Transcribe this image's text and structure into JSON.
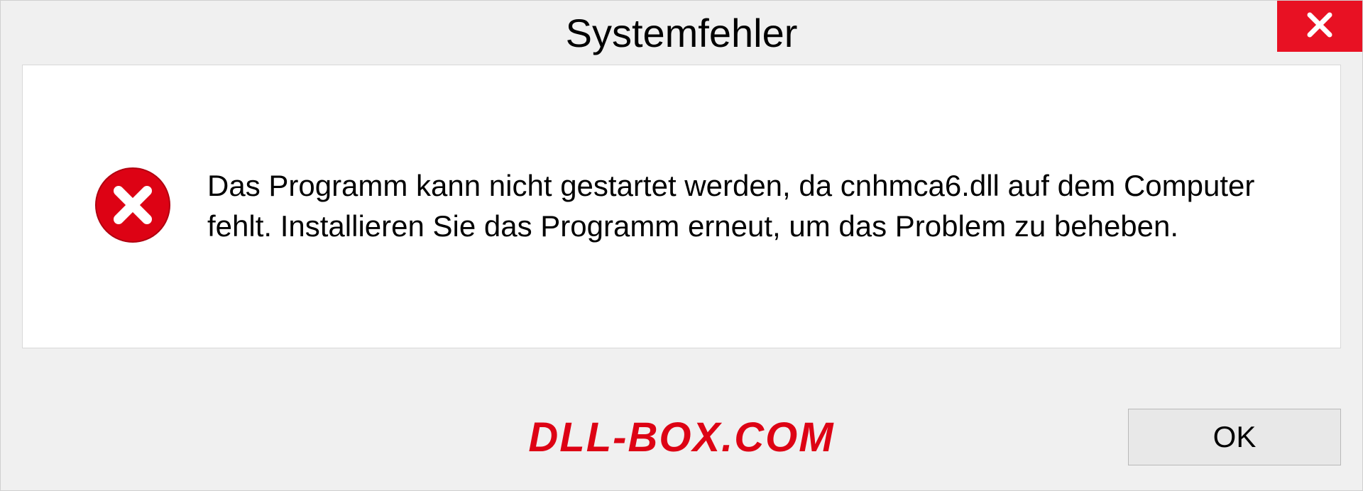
{
  "dialog": {
    "title": "Systemfehler",
    "message": "Das Programm kann nicht gestartet werden, da cnhmca6.dll auf dem Computer fehlt. Installieren Sie das Programm erneut, um das Problem zu beheben.",
    "ok_label": "OK",
    "watermark": "DLL-BOX.COM"
  },
  "colors": {
    "close_bg": "#e81123",
    "error_red": "#dd0214",
    "panel_bg": "#ffffff",
    "window_bg": "#f0f0f0"
  }
}
